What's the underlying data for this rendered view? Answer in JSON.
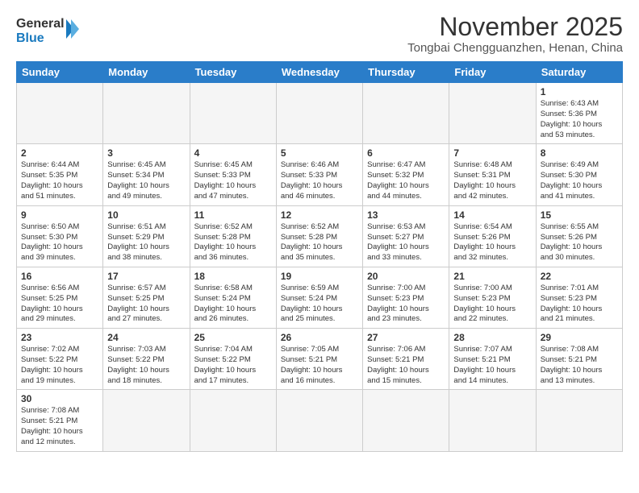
{
  "header": {
    "logo_general": "General",
    "logo_blue": "Blue",
    "month_title": "November 2025",
    "location": "Tongbai Chengguanzhen, Henan, China"
  },
  "weekdays": [
    "Sunday",
    "Monday",
    "Tuesday",
    "Wednesday",
    "Thursday",
    "Friday",
    "Saturday"
  ],
  "weeks": [
    [
      {
        "day": "",
        "info": ""
      },
      {
        "day": "",
        "info": ""
      },
      {
        "day": "",
        "info": ""
      },
      {
        "day": "",
        "info": ""
      },
      {
        "day": "",
        "info": ""
      },
      {
        "day": "",
        "info": ""
      },
      {
        "day": "1",
        "info": "Sunrise: 6:43 AM\nSunset: 5:36 PM\nDaylight: 10 hours\nand 53 minutes."
      }
    ],
    [
      {
        "day": "2",
        "info": "Sunrise: 6:44 AM\nSunset: 5:35 PM\nDaylight: 10 hours\nand 51 minutes."
      },
      {
        "day": "3",
        "info": "Sunrise: 6:45 AM\nSunset: 5:34 PM\nDaylight: 10 hours\nand 49 minutes."
      },
      {
        "day": "4",
        "info": "Sunrise: 6:45 AM\nSunset: 5:33 PM\nDaylight: 10 hours\nand 47 minutes."
      },
      {
        "day": "5",
        "info": "Sunrise: 6:46 AM\nSunset: 5:33 PM\nDaylight: 10 hours\nand 46 minutes."
      },
      {
        "day": "6",
        "info": "Sunrise: 6:47 AM\nSunset: 5:32 PM\nDaylight: 10 hours\nand 44 minutes."
      },
      {
        "day": "7",
        "info": "Sunrise: 6:48 AM\nSunset: 5:31 PM\nDaylight: 10 hours\nand 42 minutes."
      },
      {
        "day": "8",
        "info": "Sunrise: 6:49 AM\nSunset: 5:30 PM\nDaylight: 10 hours\nand 41 minutes."
      }
    ],
    [
      {
        "day": "9",
        "info": "Sunrise: 6:50 AM\nSunset: 5:30 PM\nDaylight: 10 hours\nand 39 minutes."
      },
      {
        "day": "10",
        "info": "Sunrise: 6:51 AM\nSunset: 5:29 PM\nDaylight: 10 hours\nand 38 minutes."
      },
      {
        "day": "11",
        "info": "Sunrise: 6:52 AM\nSunset: 5:28 PM\nDaylight: 10 hours\nand 36 minutes."
      },
      {
        "day": "12",
        "info": "Sunrise: 6:52 AM\nSunset: 5:28 PM\nDaylight: 10 hours\nand 35 minutes."
      },
      {
        "day": "13",
        "info": "Sunrise: 6:53 AM\nSunset: 5:27 PM\nDaylight: 10 hours\nand 33 minutes."
      },
      {
        "day": "14",
        "info": "Sunrise: 6:54 AM\nSunset: 5:26 PM\nDaylight: 10 hours\nand 32 minutes."
      },
      {
        "day": "15",
        "info": "Sunrise: 6:55 AM\nSunset: 5:26 PM\nDaylight: 10 hours\nand 30 minutes."
      }
    ],
    [
      {
        "day": "16",
        "info": "Sunrise: 6:56 AM\nSunset: 5:25 PM\nDaylight: 10 hours\nand 29 minutes."
      },
      {
        "day": "17",
        "info": "Sunrise: 6:57 AM\nSunset: 5:25 PM\nDaylight: 10 hours\nand 27 minutes."
      },
      {
        "day": "18",
        "info": "Sunrise: 6:58 AM\nSunset: 5:24 PM\nDaylight: 10 hours\nand 26 minutes."
      },
      {
        "day": "19",
        "info": "Sunrise: 6:59 AM\nSunset: 5:24 PM\nDaylight: 10 hours\nand 25 minutes."
      },
      {
        "day": "20",
        "info": "Sunrise: 7:00 AM\nSunset: 5:23 PM\nDaylight: 10 hours\nand 23 minutes."
      },
      {
        "day": "21",
        "info": "Sunrise: 7:00 AM\nSunset: 5:23 PM\nDaylight: 10 hours\nand 22 minutes."
      },
      {
        "day": "22",
        "info": "Sunrise: 7:01 AM\nSunset: 5:23 PM\nDaylight: 10 hours\nand 21 minutes."
      }
    ],
    [
      {
        "day": "23",
        "info": "Sunrise: 7:02 AM\nSunset: 5:22 PM\nDaylight: 10 hours\nand 19 minutes."
      },
      {
        "day": "24",
        "info": "Sunrise: 7:03 AM\nSunset: 5:22 PM\nDaylight: 10 hours\nand 18 minutes."
      },
      {
        "day": "25",
        "info": "Sunrise: 7:04 AM\nSunset: 5:22 PM\nDaylight: 10 hours\nand 17 minutes."
      },
      {
        "day": "26",
        "info": "Sunrise: 7:05 AM\nSunset: 5:21 PM\nDaylight: 10 hours\nand 16 minutes."
      },
      {
        "day": "27",
        "info": "Sunrise: 7:06 AM\nSunset: 5:21 PM\nDaylight: 10 hours\nand 15 minutes."
      },
      {
        "day": "28",
        "info": "Sunrise: 7:07 AM\nSunset: 5:21 PM\nDaylight: 10 hours\nand 14 minutes."
      },
      {
        "day": "29",
        "info": "Sunrise: 7:08 AM\nSunset: 5:21 PM\nDaylight: 10 hours\nand 13 minutes."
      }
    ],
    [
      {
        "day": "30",
        "info": "Sunrise: 7:08 AM\nSunset: 5:21 PM\nDaylight: 10 hours\nand 12 minutes."
      },
      {
        "day": "",
        "info": ""
      },
      {
        "day": "",
        "info": ""
      },
      {
        "day": "",
        "info": ""
      },
      {
        "day": "",
        "info": ""
      },
      {
        "day": "",
        "info": ""
      },
      {
        "day": "",
        "info": ""
      }
    ]
  ]
}
